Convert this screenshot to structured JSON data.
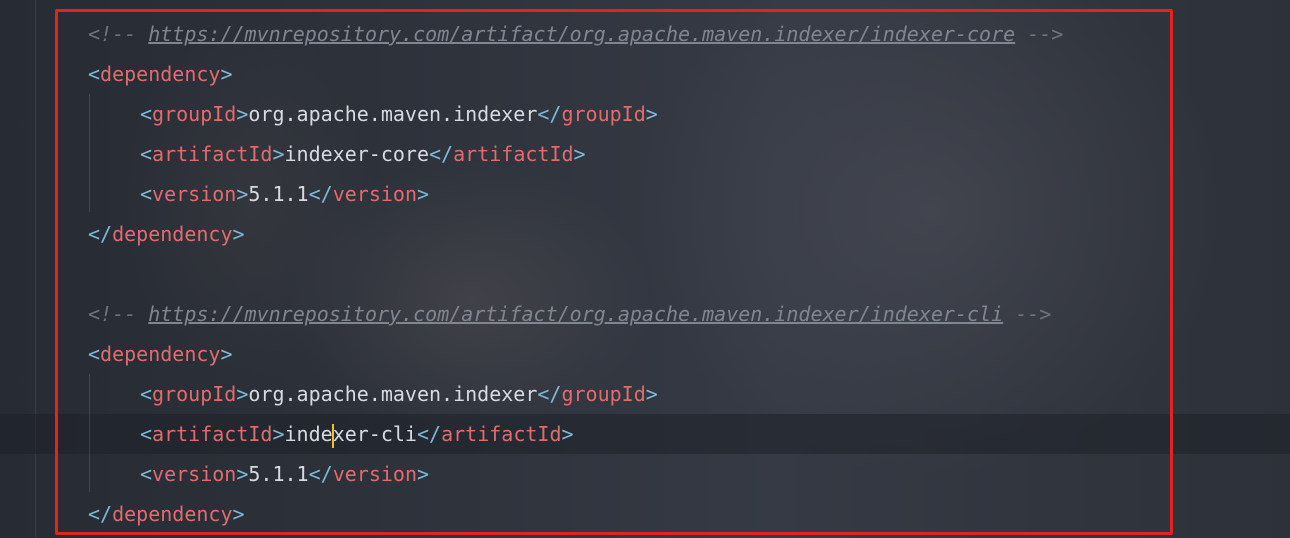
{
  "comments": [
    {
      "open": "<!--",
      "url": "https://mvnrepository.com/artifact/org.apache.maven.indexer/indexer-core",
      "close": "-->"
    },
    {
      "open": "<!--",
      "url": "https://mvnrepository.com/artifact/org.apache.maven.indexer/indexer-cli",
      "close": "-->"
    }
  ],
  "tags": {
    "dependency": "dependency",
    "groupId": "groupId",
    "artifactId": "artifactId",
    "version": "version"
  },
  "dependencies": [
    {
      "groupId": "org.apache.maven.indexer",
      "artifactId": "indexer-core",
      "version": "5.1.1"
    },
    {
      "groupId": "org.apache.maven.indexer",
      "artifactId_before_caret": "inde",
      "artifactId_after_caret": "xer-cli",
      "version": "5.1.1"
    }
  ],
  "colors": {
    "tag_bracket": "#7fb9d8",
    "tag_name": "#e06c6c",
    "comment": "#6e747d",
    "text": "#d7dae0",
    "caret": "#f0c030",
    "highlight_box": "#e3231f"
  }
}
